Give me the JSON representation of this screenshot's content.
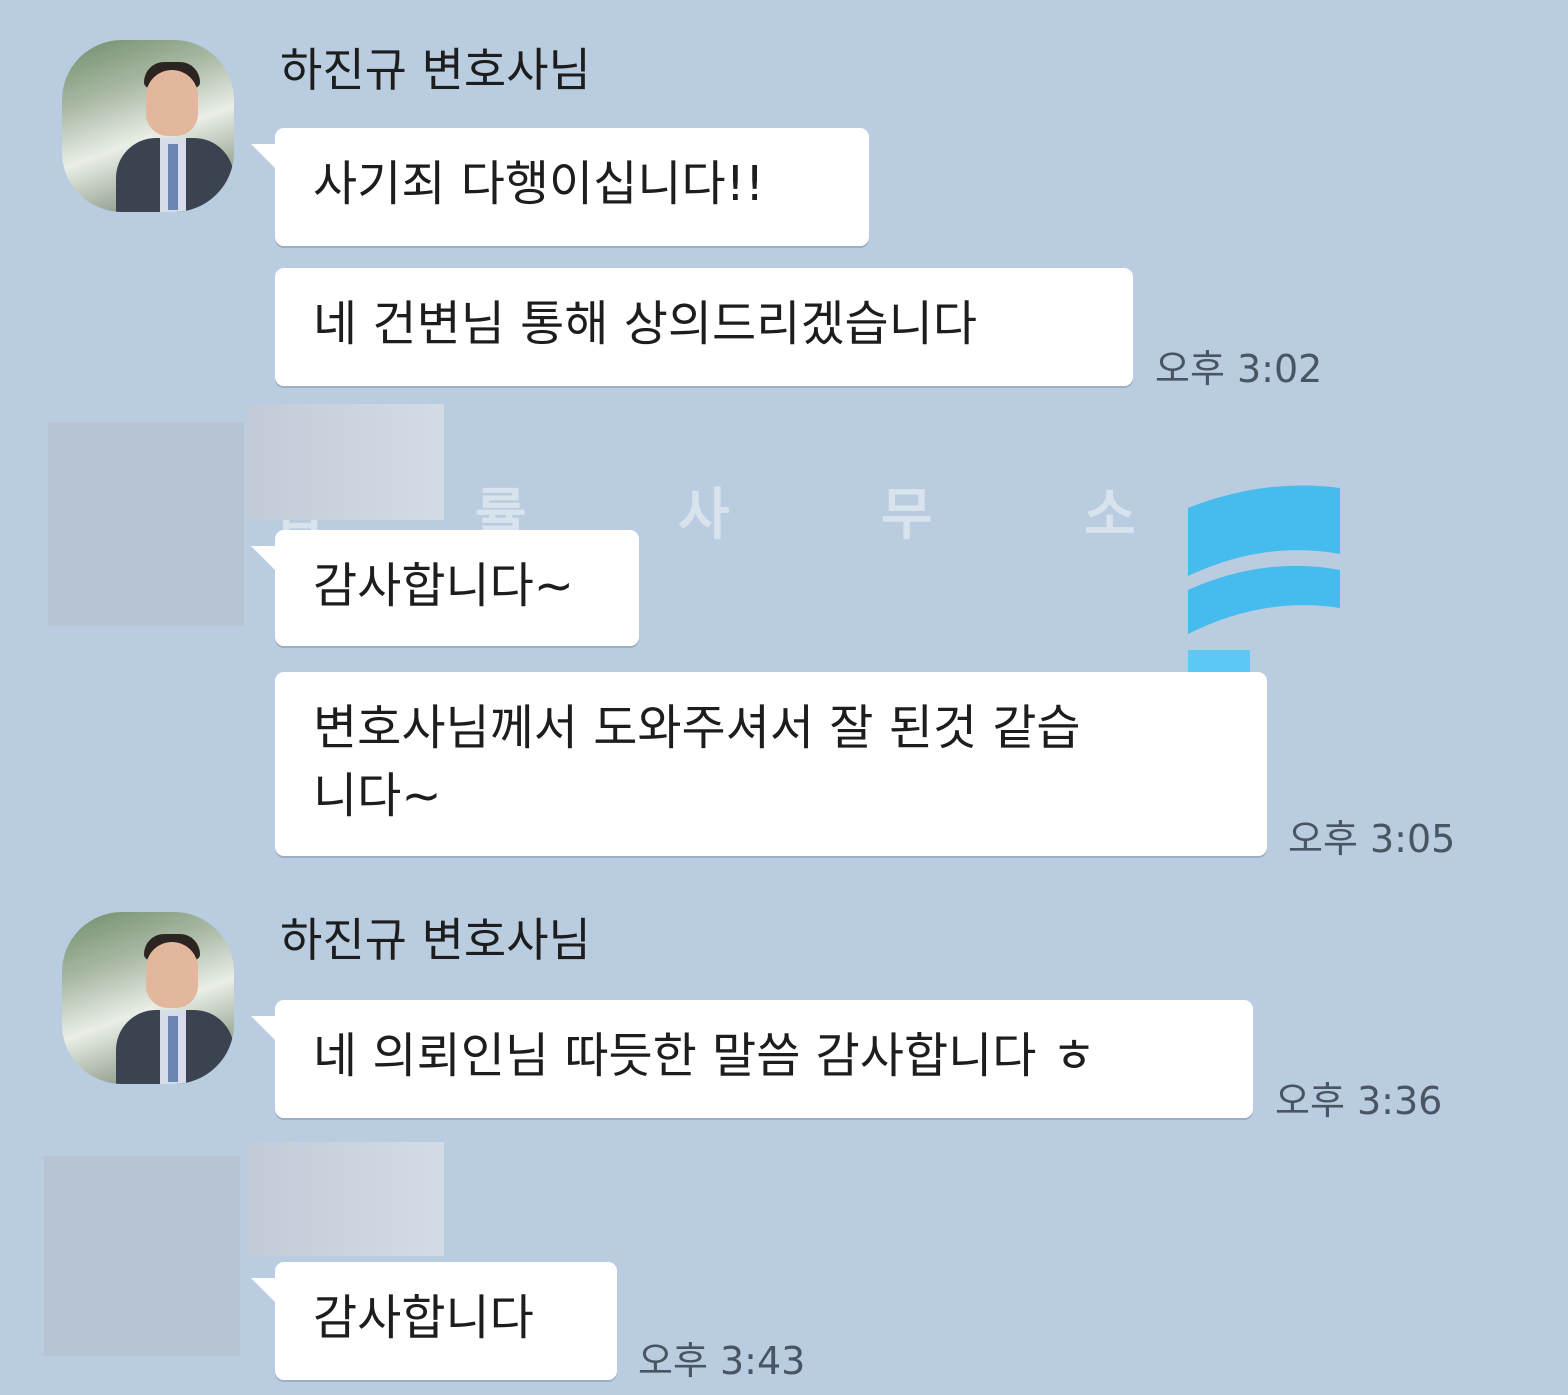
{
  "chat": {
    "groups": [
      {
        "sender": "하진규 변호사님",
        "messages": [
          "사기죄 다행이십니다!!",
          "네 건변님 통해 상의드리겠습니다"
        ],
        "time": "오후 3:02"
      },
      {
        "sender": "",
        "messages": [
          "감사합니다~",
          "변호사님께서 도와주셔서 잘 된것 같습",
          "니다~"
        ],
        "time": "오후 3:05"
      },
      {
        "sender": "하진규 변호사님",
        "messages": [
          "네 의뢰인님 따듯한 말씀 감사합니다 ㅎ"
        ],
        "time": "오후 3:36"
      },
      {
        "sender": "",
        "messages": [
          "감사합니다"
        ],
        "time": "오후 3:43"
      }
    ]
  },
  "watermark": {
    "text": "법 률 사 무 소",
    "brand_color": "#45bbee"
  },
  "colors": {
    "background": "#b9cce0",
    "bubble": "#ffffff"
  }
}
